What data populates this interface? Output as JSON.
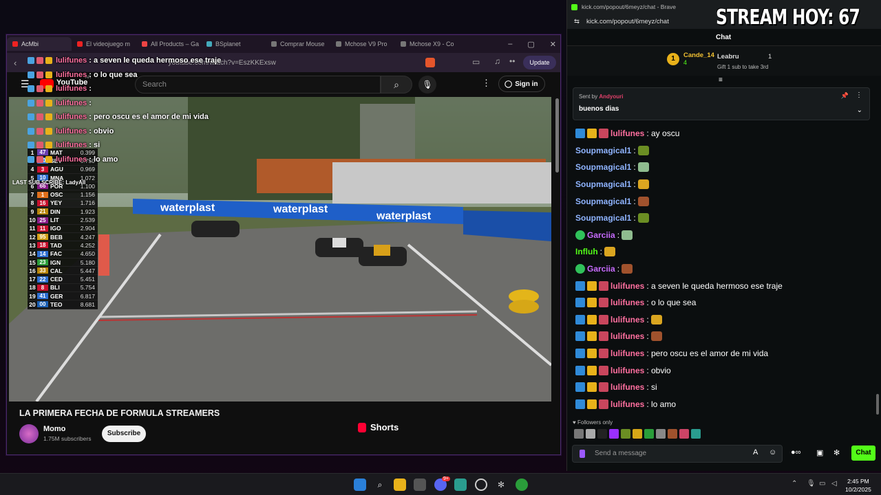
{
  "youtube_window": {
    "tabs": [
      "AcMbi",
      "El videojuego m",
      "All Products – Ga",
      "BSplanet",
      "Comprar Mouse",
      "Mchose V9 Pro",
      "Mchose X9 - Co"
    ],
    "url": "youtube.com/watch?v=EszKKExsw",
    "update_label": "Update",
    "logo": "YouTube",
    "logo_region": "AR",
    "search_placeholder": "Search",
    "sign_in": "Sign in",
    "video_title": "LA PRIMERA FECHA DE FORMULA STREAMERS",
    "channel_name": "Momo",
    "channel_subs": "1.75M subscribers",
    "subscribe_label": "Subscribe",
    "shorts_label": "Shorts",
    "banner_text": "waterplast",
    "last_sub": "LAST SUB SCRIBE: LadyAlI"
  },
  "overlay_chat": [
    {
      "user": "lulifunes",
      "text": ": a seven le queda hermoso ese traje"
    },
    {
      "user": "lulifunes",
      "text": ": o lo que sea"
    },
    {
      "user": "lulifunes",
      "text": ":"
    },
    {
      "user": "lulifunes",
      "text": ":"
    },
    {
      "user": "lulifunes",
      "text": ": pero oscu es el amor de mi vida"
    },
    {
      "user": "lulifunes",
      "text": ": obvio"
    },
    {
      "user": "lulifunes",
      "text": ": si"
    },
    {
      "user": "lulifunes",
      "text": ": lo amo"
    }
  ],
  "leaderboard": [
    {
      "pos": "1",
      "num": "47",
      "name": "MAT",
      "gap": "0.399",
      "color": "#6a3fb0"
    },
    {
      "pos": "3",
      "num": "30",
      "name": "SEV",
      "gap": "0.750",
      "color": "#2d6fd1"
    },
    {
      "pos": "4",
      "num": "3",
      "name": "AGU",
      "gap": "0.969",
      "color": "#c8102e"
    },
    {
      "pos": "5",
      "num": "10",
      "name": "MNA",
      "gap": "1.072",
      "color": "#2d6fd1"
    },
    {
      "pos": "6",
      "num": "66",
      "name": "POR",
      "gap": "1.100",
      "color": "#8a1c8a"
    },
    {
      "pos": "7",
      "num": "1",
      "name": "OSC",
      "gap": "1.156",
      "color": "#e0701b"
    },
    {
      "pos": "8",
      "num": "16",
      "name": "YEY",
      "gap": "1.716",
      "color": "#c8102e"
    },
    {
      "pos": "9",
      "num": "21",
      "name": "DIN",
      "gap": "1.923",
      "color": "#b8860b"
    },
    {
      "pos": "10",
      "num": "25",
      "name": "LIT",
      "gap": "2.539",
      "color": "#8a1c8a"
    },
    {
      "pos": "11",
      "num": "11",
      "name": "IGO",
      "gap": "2.904",
      "color": "#c8102e"
    },
    {
      "pos": "12",
      "num": "95",
      "name": "BEB",
      "gap": "4.247",
      "color": "#d4a017"
    },
    {
      "pos": "13",
      "num": "18",
      "name": "TAD",
      "gap": "4.252",
      "color": "#c8102e"
    },
    {
      "pos": "14",
      "num": "14",
      "name": "FAC",
      "gap": "4.650",
      "color": "#2d6fd1"
    },
    {
      "pos": "15",
      "num": "23",
      "name": "IGN",
      "gap": "5.180",
      "color": "#2a9d3a"
    },
    {
      "pos": "16",
      "num": "33",
      "name": "CAL",
      "gap": "5.447",
      "color": "#b8860b"
    },
    {
      "pos": "17",
      "num": "22",
      "name": "CED",
      "gap": "5.451",
      "color": "#2d6fd1"
    },
    {
      "pos": "18",
      "num": "8",
      "name": "BLI",
      "gap": "5.754",
      "color": "#c8102e"
    },
    {
      "pos": "19",
      "num": "41",
      "name": "GER",
      "gap": "6.817",
      "color": "#2d6fd1"
    },
    {
      "pos": "20",
      "num": "00",
      "name": "TEO",
      "gap": "8.681",
      "color": "#1a5fb4"
    }
  ],
  "kick_window": {
    "window_title": "kick.com/popout/6meyz/chat - Brave",
    "url": "kick.com/popout/6meyz/chat",
    "stream_overlay": "STREAM HOY: 67",
    "chat_label": "Chat",
    "leader1_name": "Cande_14",
    "leader1_count": "4",
    "leader2_name": "Leabru",
    "leader2_count": "1",
    "gift_hint": "Gift 1 sub to take 3rd",
    "pinned_sent_by": "Sent by",
    "pinned_user": "Andyouri",
    "pinned_message": "buenos dias",
    "followers_only": "Followers only",
    "message_placeholder": "Send a message",
    "chat_button": "Chat"
  },
  "kick_messages": [
    {
      "user": "lulifunes",
      "text": ": ay oscu",
      "color": "#ff6f9f",
      "badges": true
    },
    {
      "user": "Soupmagical1",
      "text": ":",
      "color": "#8fb4ff",
      "badges": false
    },
    {
      "user": "Soupmagical1",
      "text": ":",
      "color": "#8fb4ff",
      "badges": false
    },
    {
      "user": "Soupmagical1",
      "text": ":",
      "color": "#8fb4ff",
      "badges": false
    },
    {
      "user": "Soupmagical1",
      "text": ":",
      "color": "#8fb4ff",
      "badges": false
    },
    {
      "user": "Soupmagical1",
      "text": ":",
      "color": "#8fb4ff",
      "badges": false
    },
    {
      "user": "Garciia",
      "text": ":",
      "color": "#c86bff",
      "badges": false,
      "verified": true
    },
    {
      "user": "Influh",
      "text": ":",
      "color": "#53fc18",
      "badges": false
    },
    {
      "user": "Garciia",
      "text": ":",
      "color": "#c86bff",
      "badges": false,
      "verified": true
    },
    {
      "user": "lulifunes",
      "text": ": a seven le queda hermoso ese traje",
      "color": "#ff6f9f",
      "badges": true
    },
    {
      "user": "lulifunes",
      "text": ": o lo que sea",
      "color": "#ff6f9f",
      "badges": true
    },
    {
      "user": "lulifunes",
      "text": ":",
      "color": "#ff6f9f",
      "badges": true
    },
    {
      "user": "lulifunes",
      "text": ":",
      "color": "#ff6f9f",
      "badges": true
    },
    {
      "user": "lulifunes",
      "text": ": pero oscu es el amor de mi vida",
      "color": "#ff6f9f",
      "badges": true
    },
    {
      "user": "lulifunes",
      "text": ": obvio",
      "color": "#ff6f9f",
      "badges": true
    },
    {
      "user": "lulifunes",
      "text": ": si",
      "color": "#ff6f9f",
      "badges": true
    },
    {
      "user": "lulifunes",
      "text": ": lo amo",
      "color": "#ff6f9f",
      "badges": true
    }
  ],
  "taskbar": {
    "time": "2:45 PM",
    "date": "10/2/2025",
    "discord_badge": "9+"
  },
  "colors": {
    "kick_green": "#53fc18",
    "accent_purple": "#4a2a6a"
  }
}
